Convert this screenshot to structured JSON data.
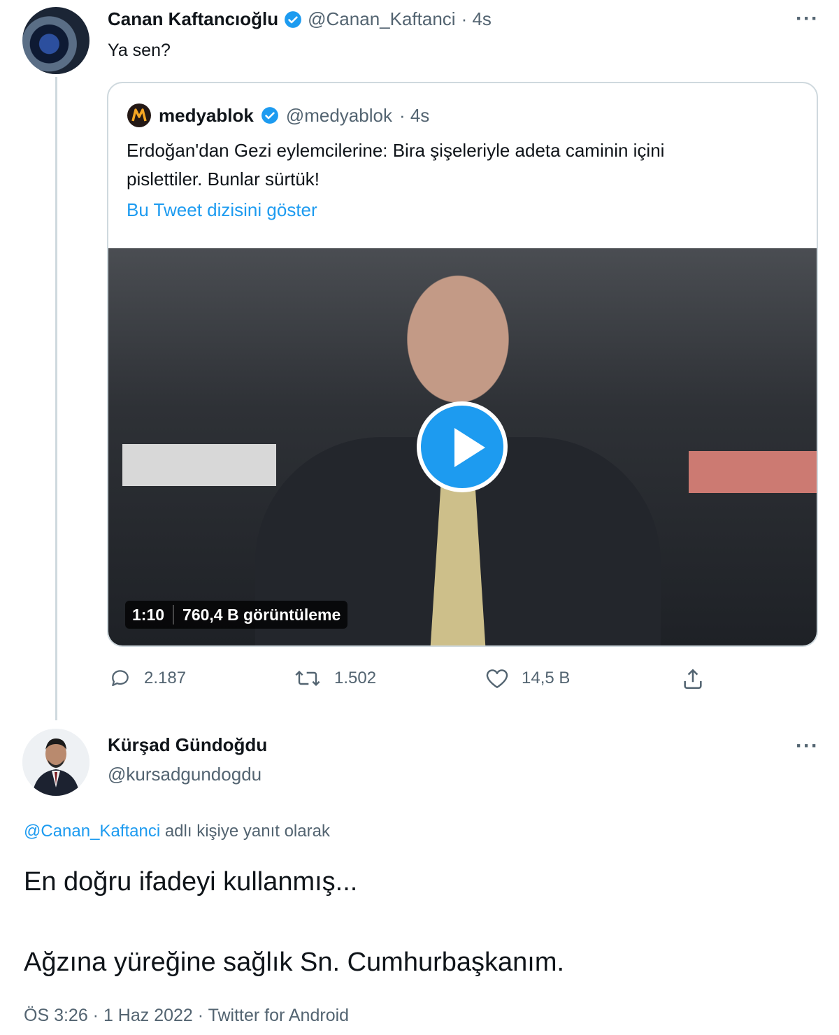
{
  "tweet1": {
    "author_name": "Canan Kaftancıoğlu",
    "author_handle": "@Canan_Kaftanci",
    "time": "· 4s",
    "text": "Ya sen?",
    "more": "···"
  },
  "quote": {
    "author_name": "medyablok",
    "author_handle": "@medyablok",
    "time": "· 4s",
    "text_line1": "Erdoğan'dan Gezi eylemcilerine: Bira şişeleriyle adeta caminin içini",
    "text_line2": "pislettiler. Bunlar sürtük!",
    "show_thread": "Bu Tweet dizisini göster",
    "video_duration": "1:10",
    "video_views": "760,4 B görüntüleme"
  },
  "actions": {
    "replies": "2.187",
    "retweets": "1.502",
    "likes": "14,5 B"
  },
  "tweet2": {
    "author_name": "Kürşad Gündoğdu",
    "author_handle": "@kursadgundogdu",
    "more": "···",
    "reply_mention": "@Canan_Kaftanci",
    "reply_suffix": "adlı kişiye yanıt olarak",
    "text_line1": "En doğru ifadeyi kullanmış...",
    "text_line2": "Ağzına yüreğine sağlık Sn. Cumhurbaşkanım.",
    "timestamp": "ÖS 3:26 · 1 Haz 2022 · Twitter for Android"
  },
  "colors": {
    "accent": "#1d9bf0",
    "secondary_text": "#536471",
    "border": "#cfd9de"
  }
}
